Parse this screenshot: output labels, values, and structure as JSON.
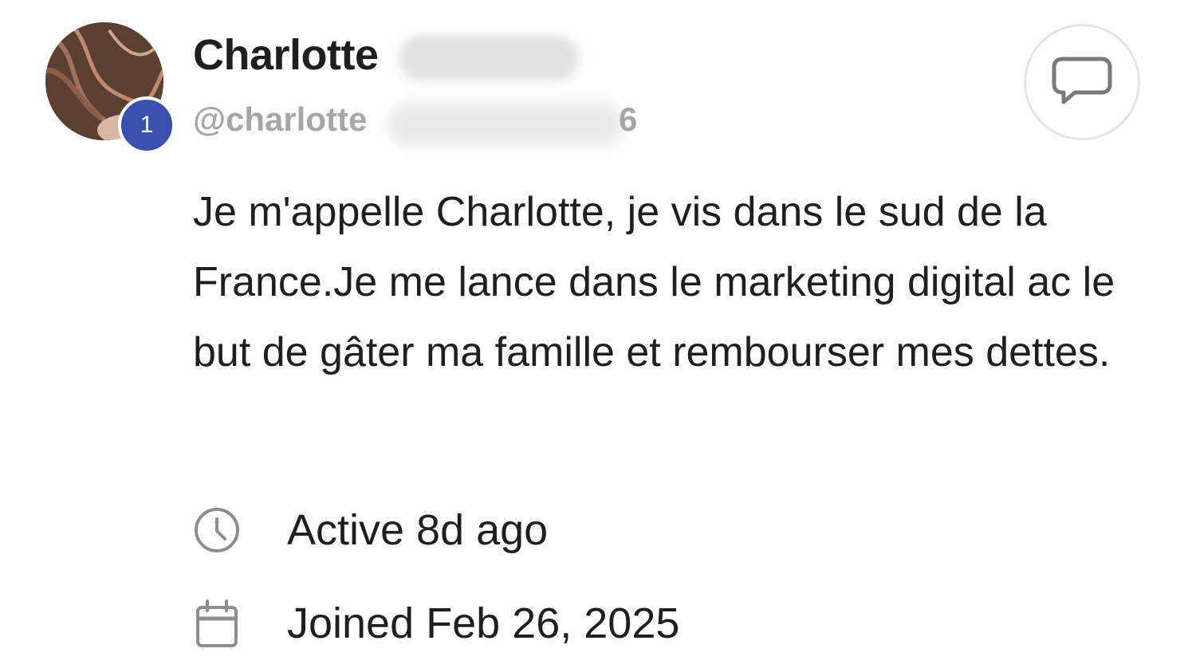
{
  "profile": {
    "display_name": "Charlotte",
    "username": "@charlotte",
    "username_tail": "6",
    "level_badge": "1",
    "avatar_icon": "avatar-photo",
    "message_button_icon": "chat-bubble-icon",
    "bio": "Je m'appelle Charlotte, je vis dans le sud de la France.Je me lance dans le marketing digital ac le but de gâter ma famille et rembourser mes dettes."
  },
  "meta": {
    "active": {
      "icon": "clock-icon",
      "text": "Active 8d ago"
    },
    "joined": {
      "icon": "calendar-icon",
      "text": "Joined Feb 26, 2025"
    }
  },
  "colors": {
    "text": "#1f1f1f",
    "muted": "#a6a6a6",
    "badge": "#3b4fae",
    "icon": "#8e8e8e",
    "border": "#e4e4e4"
  }
}
